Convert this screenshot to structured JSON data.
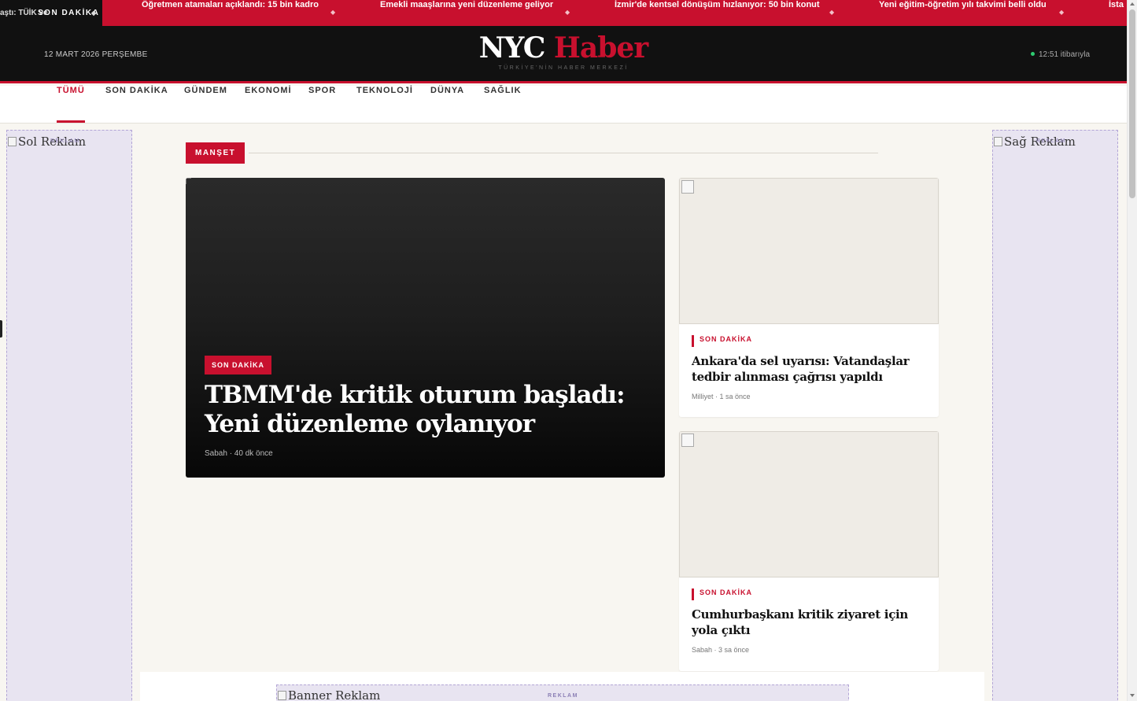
{
  "ticker": {
    "badge": "SON DAKİKA",
    "peek": "aştı: TÜİK ve",
    "items": [
      "Öğretmen atamaları açıklandı: 15 bin kadro",
      "Emekli maaşlarına yeni düzenleme geliyor",
      "İzmir'de kentsel dönüşüm hızlanıyor: 50 bin konut",
      "Yeni eğitim-öğretim yılı takvimi belli oldu",
      "İsta"
    ]
  },
  "header": {
    "date": "12 MART 2026 PERŞEMBE",
    "logo_part1": "NYC",
    "logo_part2": "Haber",
    "tagline": "TÜRKİYE'NİN HABER MERKEZİ",
    "live_text": "12:51 itibarıyla"
  },
  "nav": {
    "items": [
      "TÜMÜ",
      "SON DAKİKA",
      "GÜNDEM",
      "EKONOMİ",
      "SPOR",
      "TEKNOLOJİ",
      "DÜNYA",
      "SAĞLIK"
    ],
    "active": "TÜMÜ"
  },
  "ads": {
    "left_alt": "Sol Reklam",
    "right_alt": "Sağ Reklam",
    "banner_alt": "Banner Reklam",
    "label": "REKLAM"
  },
  "section": {
    "label": "MANŞET"
  },
  "hero": {
    "category": "SON DAKİKA",
    "title": "TBMM'de kritik oturum başladı: Yeni düzenleme oylanıyor",
    "meta": "Sabah · 40 dk önce"
  },
  "cards": [
    {
      "category": "SON DAKİKA",
      "title": "Ankara'da sel uyarısı: Vatandaşlar tedbir alınması çağrısı yapıldı",
      "meta": "Milliyet · 1 sa önce"
    },
    {
      "category": "SON DAKİKA",
      "title": "Cumhurbaşkanı kritik ziyaret için yola çıktı",
      "meta": "Sabah · 3 sa önce"
    }
  ],
  "colors": {
    "accent": "#c8102e",
    "dark": "#111111",
    "background": "#f8f6f1",
    "ad_fill": "#e8e4f1"
  }
}
